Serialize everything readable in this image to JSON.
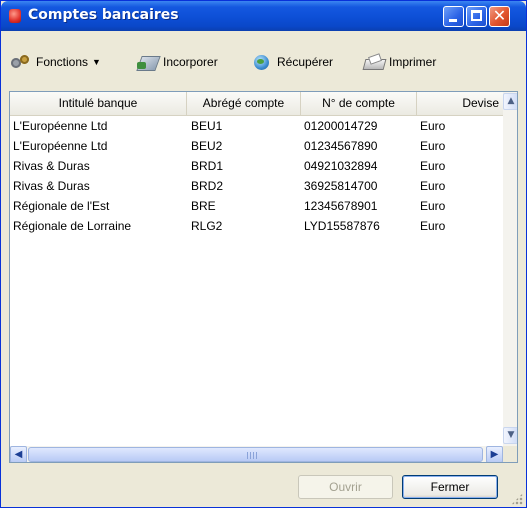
{
  "window": {
    "title": "Comptes bancaires",
    "accent_color": "#0d4fd6"
  },
  "toolbar": {
    "fonctions_label": "Fonctions",
    "incorporer_label": "Incorporer",
    "recuperer_label": "Récupérer",
    "imprimer_label": "Imprimer"
  },
  "table": {
    "columns": [
      "Intitulé banque",
      "Abrégé compte",
      "N° de compte",
      "Devise"
    ],
    "rows": [
      [
        "L'Européenne Ltd",
        "BEU1",
        "01200014729",
        "Euro"
      ],
      [
        "L'Européenne Ltd",
        "BEU2",
        "01234567890",
        "Euro"
      ],
      [
        "Rivas & Duras",
        "BRD1",
        "04921032894",
        "Euro"
      ],
      [
        "Rivas & Duras",
        "BRD2",
        "36925814700",
        "Euro"
      ],
      [
        "Régionale de l'Est",
        "BRE",
        "12345678901",
        "Euro"
      ],
      [
        "Régionale de Lorraine",
        "RLG2",
        "LYD15587876",
        "Euro"
      ]
    ]
  },
  "footer": {
    "ouvrir_label": "Ouvrir",
    "fermer_label": "Fermer"
  }
}
